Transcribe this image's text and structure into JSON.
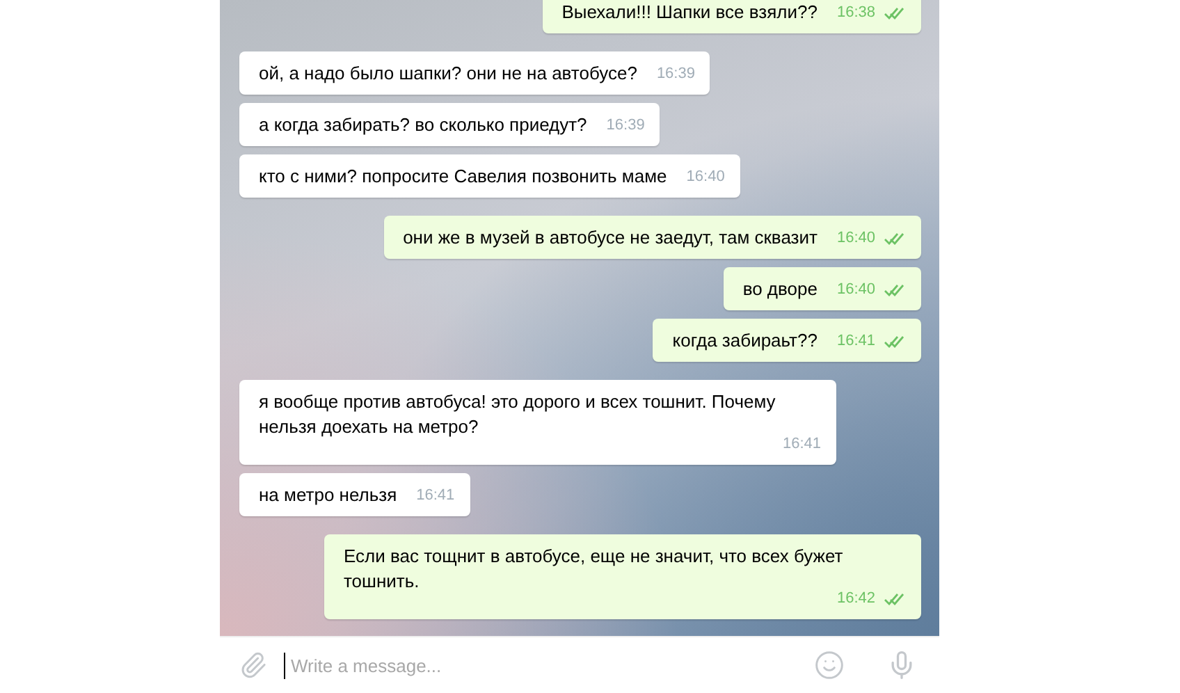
{
  "messages": [
    {
      "kind": "outgoing",
      "text": "Выехали!!! Шапки все взяли??",
      "time": "16:38",
      "read": true
    },
    {
      "kind": "incoming",
      "text": "ой, а надо было шапки? они не на автобусе?",
      "time": "16:39"
    },
    {
      "kind": "incoming",
      "text": "а когда забирать? во сколько приедут?",
      "time": "16:39"
    },
    {
      "kind": "incoming",
      "text": "кто с ними? попросите Савелия позвонить маме",
      "time": "16:40"
    },
    {
      "kind": "outgoing",
      "text": "они же в музей в автобусе не заедут, там сквазит",
      "time": "16:40",
      "read": true
    },
    {
      "kind": "outgoing",
      "text": "во дворе",
      "time": "16:40",
      "read": true
    },
    {
      "kind": "outgoing",
      "text": "когда забираьт??",
      "time": "16:41",
      "read": true
    },
    {
      "kind": "incoming",
      "text": "я вообще против автобуса! это дорого и всех тошнит. Почему нельзя доехать на метро?",
      "time": "16:41"
    },
    {
      "kind": "incoming",
      "text": "на метро нельзя",
      "time": "16:41"
    },
    {
      "kind": "outgoing",
      "text": "Если вас тощнит в автобусе, еще не значит, что всех бужет тошнить.",
      "time": "16:42",
      "read": true
    }
  ],
  "composer": {
    "placeholder": "Write a message..."
  }
}
